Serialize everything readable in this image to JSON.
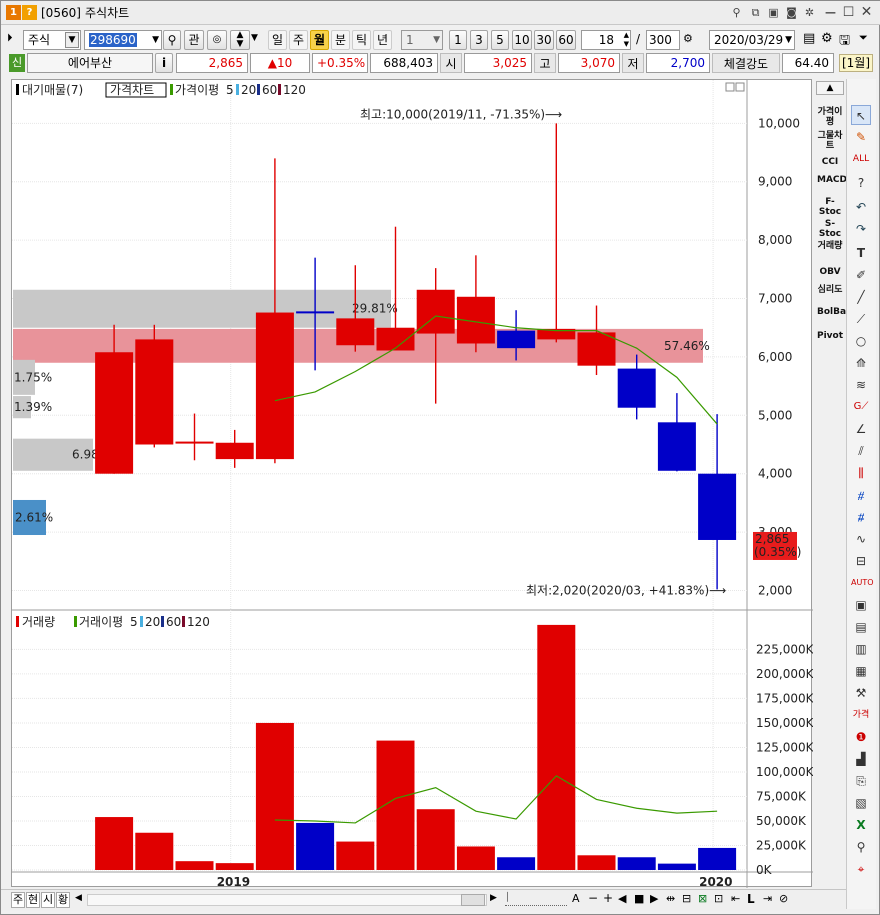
{
  "window": {
    "code": "[0560]",
    "title": "주식차트",
    "icon_label": "1",
    "icon2_label": "?"
  },
  "toolbar": {
    "market": "주식",
    "code": "298690",
    "btn_gwan": "관",
    "period_tabs": [
      "일",
      "주",
      "월",
      "분",
      "틱",
      "년"
    ],
    "active_period": "월",
    "interval_value": "1",
    "minute_buttons": [
      "1",
      "3",
      "5",
      "10",
      "30",
      "60"
    ],
    "count_value": "18",
    "slash": "/",
    "max_count": "300",
    "date": "2020/03/29"
  },
  "quote": {
    "badge": "신",
    "name": "에어부산",
    "info": "i",
    "price": "2,865",
    "change": "▲10",
    "change_pct": "+0.35%",
    "volume": "688,403",
    "open_label": "시",
    "open": "3,025",
    "high_label": "고",
    "high": "3,070",
    "low_label": "저",
    "low": "2,700",
    "strength_label": "체결강도",
    "strength": "64.40",
    "unit": "[1월]"
  },
  "price_pane": {
    "legend": {
      "vol_profile": "대기매물(7)",
      "price_chart": "가격차트",
      "ma_label": "가격이평",
      "ma": [
        "5",
        "20",
        "60",
        "120"
      ]
    },
    "high_annotation": "최고:10,000(2019/11, -71.35%)⟶",
    "low_annotation": "최저:2,020(2020/03, +41.83%)⟶",
    "current_price_tag": "2,865",
    "current_pct_tag": "(0.35%)",
    "profile_labels": [
      "29.81%",
      "57.46%",
      "1.75%",
      "1.39%",
      "6.98%",
      "2.61%"
    ],
    "y_ticks": [
      "10,000",
      "9,000",
      "8,000",
      "7,000",
      "6,000",
      "5,000",
      "4,000",
      "3,000",
      "2,000"
    ]
  },
  "volume_pane": {
    "legend": {
      "vol": "거래량",
      "ma_label": "거래이평",
      "ma": [
        "5",
        "20",
        "60",
        "120"
      ]
    },
    "y_ticks": [
      "225,000K",
      "200,000K",
      "175,000K",
      "150,000K",
      "125,000K",
      "100,000K",
      "75,000K",
      "50,000K",
      "25,000K",
      "0K"
    ]
  },
  "x_labels": [
    "2019",
    "2020"
  ],
  "indicators": [
    "가격이평",
    "그물차트",
    "CCI",
    "MACD",
    "F-Stoc",
    "S-Stoc",
    "거래량",
    "OBV",
    "심리도",
    "BolBand",
    "Pivot"
  ],
  "bottom_tabs": [
    "주",
    "현",
    "시",
    "황"
  ],
  "colors": {
    "up": "#e00000",
    "down": "#0000c8",
    "ma5": "#3a9a00",
    "profile_hi": "#e8939a",
    "profile": "#c8c8c8",
    "profile_blue": "#4a90c8",
    "tag": "#e81c1c"
  },
  "chart_data": {
    "type": "candlestick",
    "x": [
      "2018/12",
      "2019/01",
      "2019/02",
      "2019/03",
      "2019/04",
      "2019/05",
      "2019/06",
      "2019/07",
      "2019/08",
      "2019/09",
      "2019/10",
      "2019/11",
      "2019/12",
      "2020/01",
      "2020/02",
      "2020/03"
    ],
    "candles": [
      {
        "open": 4000,
        "high": 6550,
        "low": 4000,
        "close": 6080
      },
      {
        "open": 4500,
        "high": 6550,
        "low": 4450,
        "close": 6300
      },
      {
        "open": 4520,
        "high": 5030,
        "low": 4230,
        "close": 4550
      },
      {
        "open": 4250,
        "high": 4750,
        "low": 4100,
        "close": 4530
      },
      {
        "open": 4250,
        "high": 9400,
        "low": 4180,
        "close": 6760
      },
      {
        "open": 6780,
        "high": 7700,
        "low": 5770,
        "close": 6760
      },
      {
        "open": 6200,
        "high": 7570,
        "low": 6090,
        "close": 6660
      },
      {
        "open": 6110,
        "high": 8230,
        "low": 6110,
        "close": 6500
      },
      {
        "open": 6400,
        "high": 7520,
        "low": 5200,
        "close": 7150
      },
      {
        "open": 6230,
        "high": 7740,
        "low": 6080,
        "close": 7030
      },
      {
        "open": 6450,
        "high": 6800,
        "low": 5940,
        "close": 6150
      },
      {
        "open": 6300,
        "high": 10000,
        "low": 6250,
        "close": 6480
      },
      {
        "open": 5850,
        "high": 6880,
        "low": 5690,
        "close": 6420
      },
      {
        "open": 5800,
        "high": 6040,
        "low": 4930,
        "close": 5130
      },
      {
        "open": 4880,
        "high": 5380,
        "low": 4040,
        "close": 4050
      },
      {
        "open": 4000,
        "high": 5020,
        "low": 2020,
        "close": 2865
      }
    ],
    "ma5": [
      null,
      null,
      null,
      null,
      5250,
      5400,
      5750,
      6150,
      6700,
      6600,
      6500,
      6450,
      6450,
      6150,
      5650,
      4850
    ],
    "volume_k": [
      54000,
      38000,
      9000,
      7000,
      150000,
      48000,
      29000,
      132000,
      62000,
      24000,
      13000,
      250000,
      15000,
      13000,
      6500,
      22500
    ],
    "volume_ma5": [
      null,
      null,
      null,
      null,
      51000,
      50000,
      48000,
      73000,
      84000,
      60000,
      52000,
      96000,
      72000,
      63000,
      58000,
      60000
    ],
    "y_range": [
      1700,
      10400
    ],
    "volume_range": [
      0,
      255000
    ]
  }
}
